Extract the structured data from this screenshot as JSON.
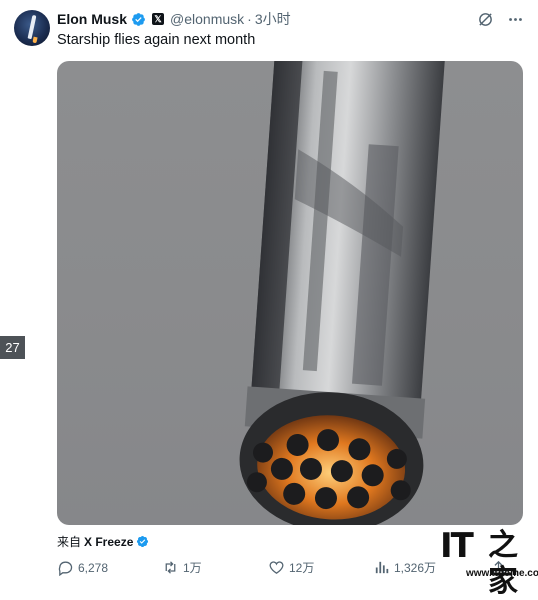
{
  "author": {
    "name": "Elon Musk",
    "badge": "𝕏",
    "handle": "@elonmusk",
    "separator": "·",
    "time": "3小时"
  },
  "icons": {
    "top_right": [
      "grok-icon",
      "more-icon"
    ]
  },
  "tweet": {
    "text": "Starship flies again next month"
  },
  "side_badge": "27",
  "source": {
    "label": "来自",
    "app": "X Freeze"
  },
  "actions": {
    "replies": "6,278",
    "reposts": "1万",
    "likes": "12万",
    "views": "1,326万"
  },
  "watermark": {
    "logo": "IT",
    "logo_cn": "之家",
    "url": "www.ithome.com"
  },
  "colors": {
    "verified": "#1d9bf0",
    "muted": "#536471",
    "text": "#0f1419"
  }
}
